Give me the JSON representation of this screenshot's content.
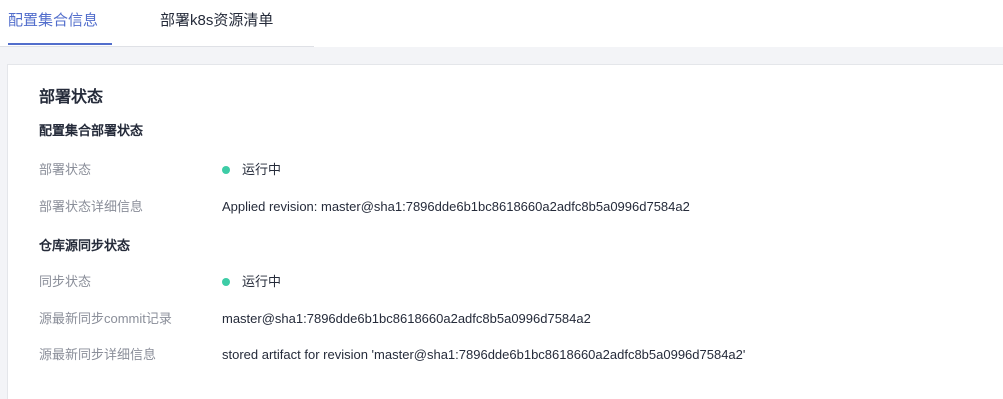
{
  "tabs": [
    {
      "label": "配置集合信息",
      "active": true
    },
    {
      "label": "部署k8s资源清单",
      "active": false
    }
  ],
  "colors": {
    "accent": "#526ecc",
    "running": "#3dcca6",
    "label": "#8a8e99",
    "text": "#252b3a",
    "background": "#f3f4f7"
  },
  "section": {
    "title": "部署状态",
    "deploy": {
      "title": "配置集合部署状态",
      "status_label": "部署状态",
      "status_value": "运行中",
      "detail_label": "部署状态详细信息",
      "detail_value": "Applied revision: master@sha1:7896dde6b1bc8618660a2adfc8b5a0996d7584a2"
    },
    "repo": {
      "title": "仓库源同步状态",
      "sync_label": "同步状态",
      "sync_value": "运行中",
      "commit_label": "源最新同步commit记录",
      "commit_value": "master@sha1:7896dde6b1bc8618660a2adfc8b5a0996d7584a2",
      "detail_label": "源最新同步详细信息",
      "detail_value": "stored artifact for revision 'master@sha1:7896dde6b1bc8618660a2adfc8b5a0996d7584a2'"
    }
  }
}
